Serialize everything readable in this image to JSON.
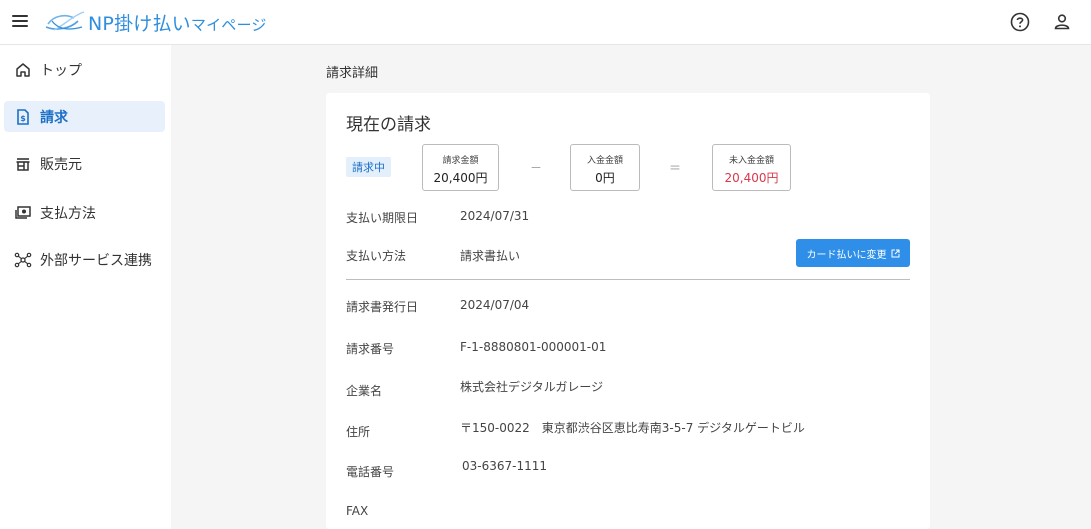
{
  "header": {
    "menu_icon": "hamburger-menu-icon",
    "logo_text": "NP掛け払い",
    "logo_sub": "マイページ",
    "help_icon": "help-circle-icon",
    "user_icon": "user-icon"
  },
  "sidebar": {
    "items": [
      {
        "label": "トップ",
        "icon": "home-icon"
      },
      {
        "label": "請求",
        "icon": "invoice-icon",
        "active": true
      },
      {
        "label": "販売元",
        "icon": "store-icon"
      },
      {
        "label": "支払方法",
        "icon": "payment-icon"
      },
      {
        "label": "外部サービス連携",
        "icon": "network-icon"
      }
    ]
  },
  "main": {
    "page_title": "請求詳細",
    "card_title": "現在の請求",
    "status_badge": "請求中",
    "amounts": {
      "billed_label": "請求金額",
      "billed_value": "20,400円",
      "minus": "－",
      "paid_label": "入金金額",
      "paid_value": "0円",
      "equals": "＝",
      "unpaid_label": "未入金金額",
      "unpaid_value": "20,400円"
    },
    "due_date_label": "支払い期限日",
    "due_date_value": "2024/07/31",
    "method_label": "支払い方法",
    "method_value": "請求書払い",
    "change_button": "カード払いに変更",
    "details": [
      {
        "label": "請求書発行日",
        "value": "2024/07/04"
      },
      {
        "label": "請求番号",
        "value": "F-1-8880801-000001-01"
      },
      {
        "label": "企業名",
        "value": "株式会社デジタルガレージ"
      },
      {
        "label": "住所",
        "value": "〒150-0022　東京都渋谷区恵比寿南3-5-7 デジタルゲートビル"
      },
      {
        "label": "電話番号",
        "value": "03-6367-1111"
      },
      {
        "label": "FAX",
        "value": ""
      }
    ]
  },
  "colors": {
    "accent": "#2f8fe8",
    "active_bg": "#e8f1fb",
    "alert": "#d8384a"
  }
}
